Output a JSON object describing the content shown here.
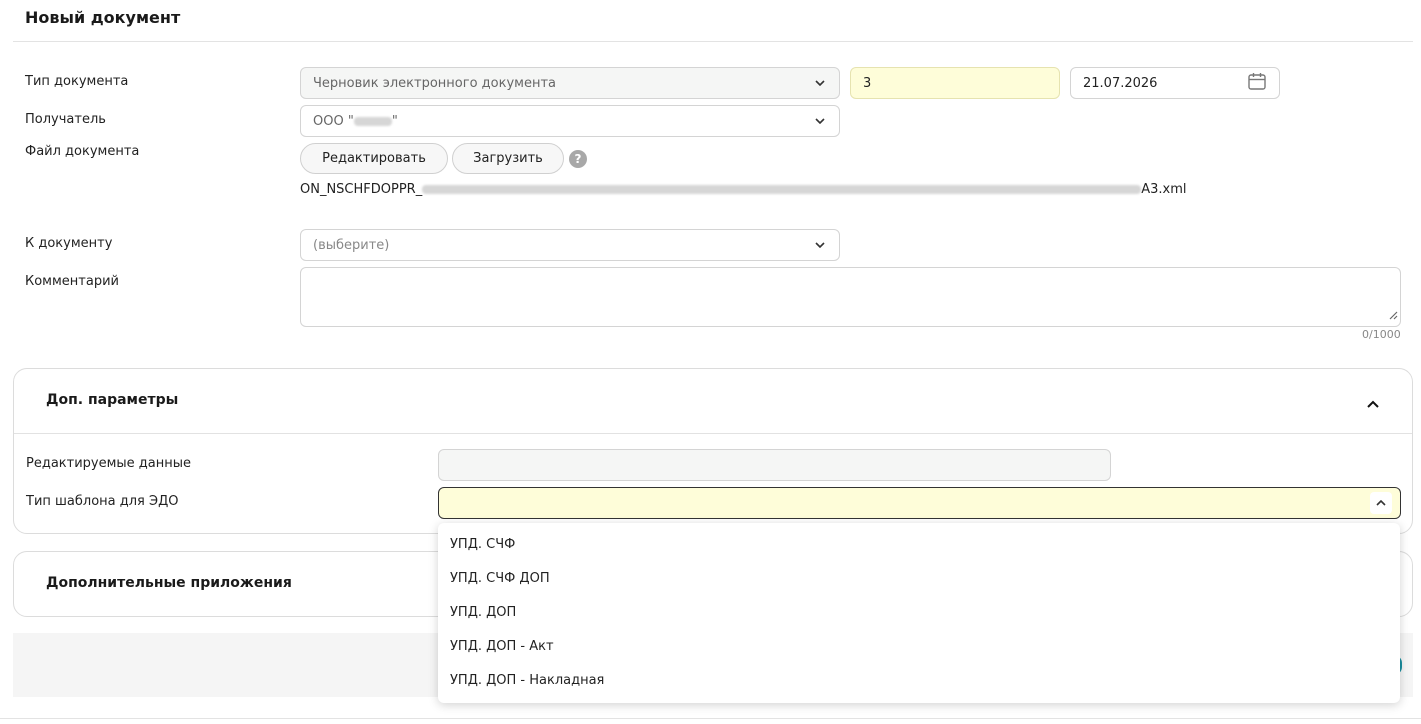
{
  "page": {
    "title": "Новый документ"
  },
  "form": {
    "doc_type": {
      "label": "Тип документа",
      "value": "Черновик электронного документа",
      "number": "3",
      "date": "21.07.2026"
    },
    "recipient": {
      "label": "Получатель",
      "value_prefix": "ООО \"",
      "value_suffix": "\""
    },
    "file": {
      "label": "Файл документа",
      "edit_button": "Редактировать",
      "upload_button": "Загрузить",
      "help": "?",
      "filename_prefix": "ON_NSCHFDOPPR_",
      "filename_suffix": "A3.xml"
    },
    "to_document": {
      "label": "К документу",
      "placeholder": "(выберите)"
    },
    "comment": {
      "label": "Комментарий",
      "counter": "0/1000"
    }
  },
  "extra_params": {
    "title": "Доп. параметры",
    "editable_data": {
      "label": "Редактируемые данные",
      "value": ""
    },
    "template_type": {
      "label": "Тип шаблона для ЭДО",
      "value": "",
      "options": [
        "УПД. СЧФ",
        "УПД. СЧФ ДОП",
        "УПД. ДОП",
        "УПД. ДОП - Акт",
        "УПД. ДОП - Накладная"
      ]
    }
  },
  "attachments": {
    "title": "Дополнительные приложения"
  }
}
